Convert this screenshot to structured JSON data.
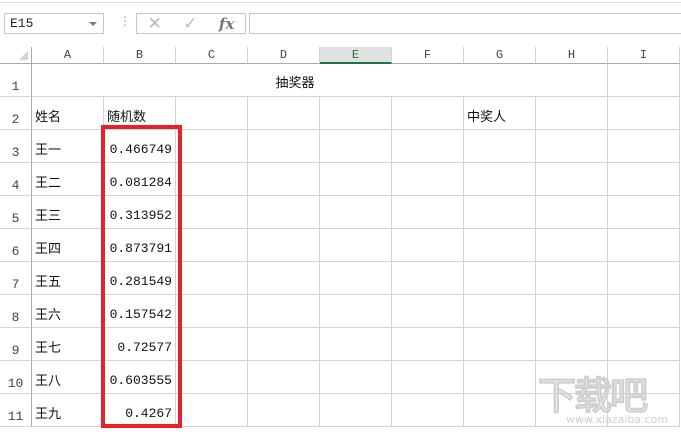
{
  "name_box": "E15",
  "formula_bar": {
    "cancel_icon": "✕",
    "enter_icon": "✓",
    "fx_label": "fx",
    "value": ""
  },
  "columns": [
    "A",
    "B",
    "C",
    "D",
    "E",
    "F",
    "G",
    "H",
    "I"
  ],
  "selected_column": "E",
  "rows": [
    "1",
    "2",
    "3",
    "4",
    "5",
    "6",
    "7",
    "8",
    "9",
    "10",
    "11"
  ],
  "title": "抽奖器",
  "headers": {
    "name": "姓名",
    "random": "随机数",
    "winner": "中奖人"
  },
  "entries": [
    {
      "name": "王一",
      "value": "0.466749"
    },
    {
      "name": "王二",
      "value": "0.081284"
    },
    {
      "name": "王三",
      "value": "0.313952"
    },
    {
      "name": "王四",
      "value": "0.873791"
    },
    {
      "name": "王五",
      "value": "0.281549"
    },
    {
      "name": "王六",
      "value": "0.157542"
    },
    {
      "name": "王七",
      "value": "0.72577"
    },
    {
      "name": "王八",
      "value": "0.603555"
    },
    {
      "name": "王九",
      "value": "0.4267"
    }
  ],
  "highlight_color": "#e8202a",
  "watermark": {
    "logo": "下载吧",
    "url": "www.xiazaiba.com"
  }
}
